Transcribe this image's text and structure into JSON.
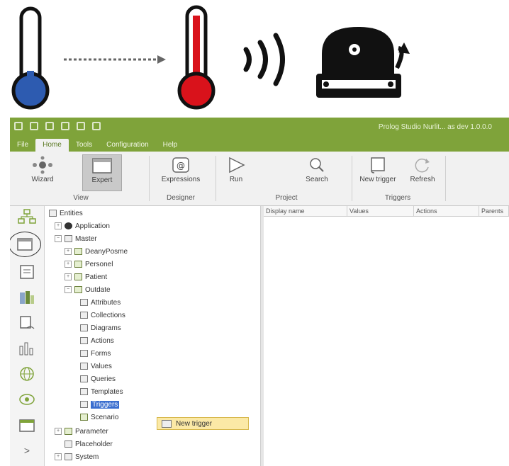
{
  "window": {
    "title": "Prolog Studio  Nurlit... as dev  1.0.0.0"
  },
  "menu": [
    "File",
    "Home",
    "Tools",
    "Configuration",
    "Help"
  ],
  "ribbon": {
    "buttons": {
      "wizard": "Wizard",
      "expert": "Expert",
      "expressions": "Expressions",
      "run": "Run",
      "search": "Search",
      "new_trigger": "New trigger",
      "refresh": "Refresh"
    },
    "groups": {
      "view": "View",
      "designer": "Designer",
      "project": "Project",
      "triggers": "Triggers"
    }
  },
  "tree": {
    "root": "Entities",
    "application": "Application",
    "master": "Master",
    "children": {
      "deanery": "DeanyPosme",
      "personnel": "Personel",
      "patient": "Patient",
      "outdate": "Outdate"
    },
    "outdate_children": [
      "Attributes",
      "Collections",
      "Diagrams",
      "Actions",
      "Forms",
      "Values",
      "Queries",
      "Templates",
      "Triggers",
      "Scenario"
    ],
    "after": [
      "Parameter",
      "Placeholder",
      "System"
    ]
  },
  "context_menu": {
    "item": "New trigger"
  },
  "grid": {
    "columns": [
      "Display name",
      "Values",
      "Actions",
      "Parents"
    ]
  },
  "colors": {
    "accent": "#7fa33a",
    "selection": "#3a6ecf",
    "thermo_cold": "#2d5bb0",
    "thermo_hot": "#d9121b"
  }
}
